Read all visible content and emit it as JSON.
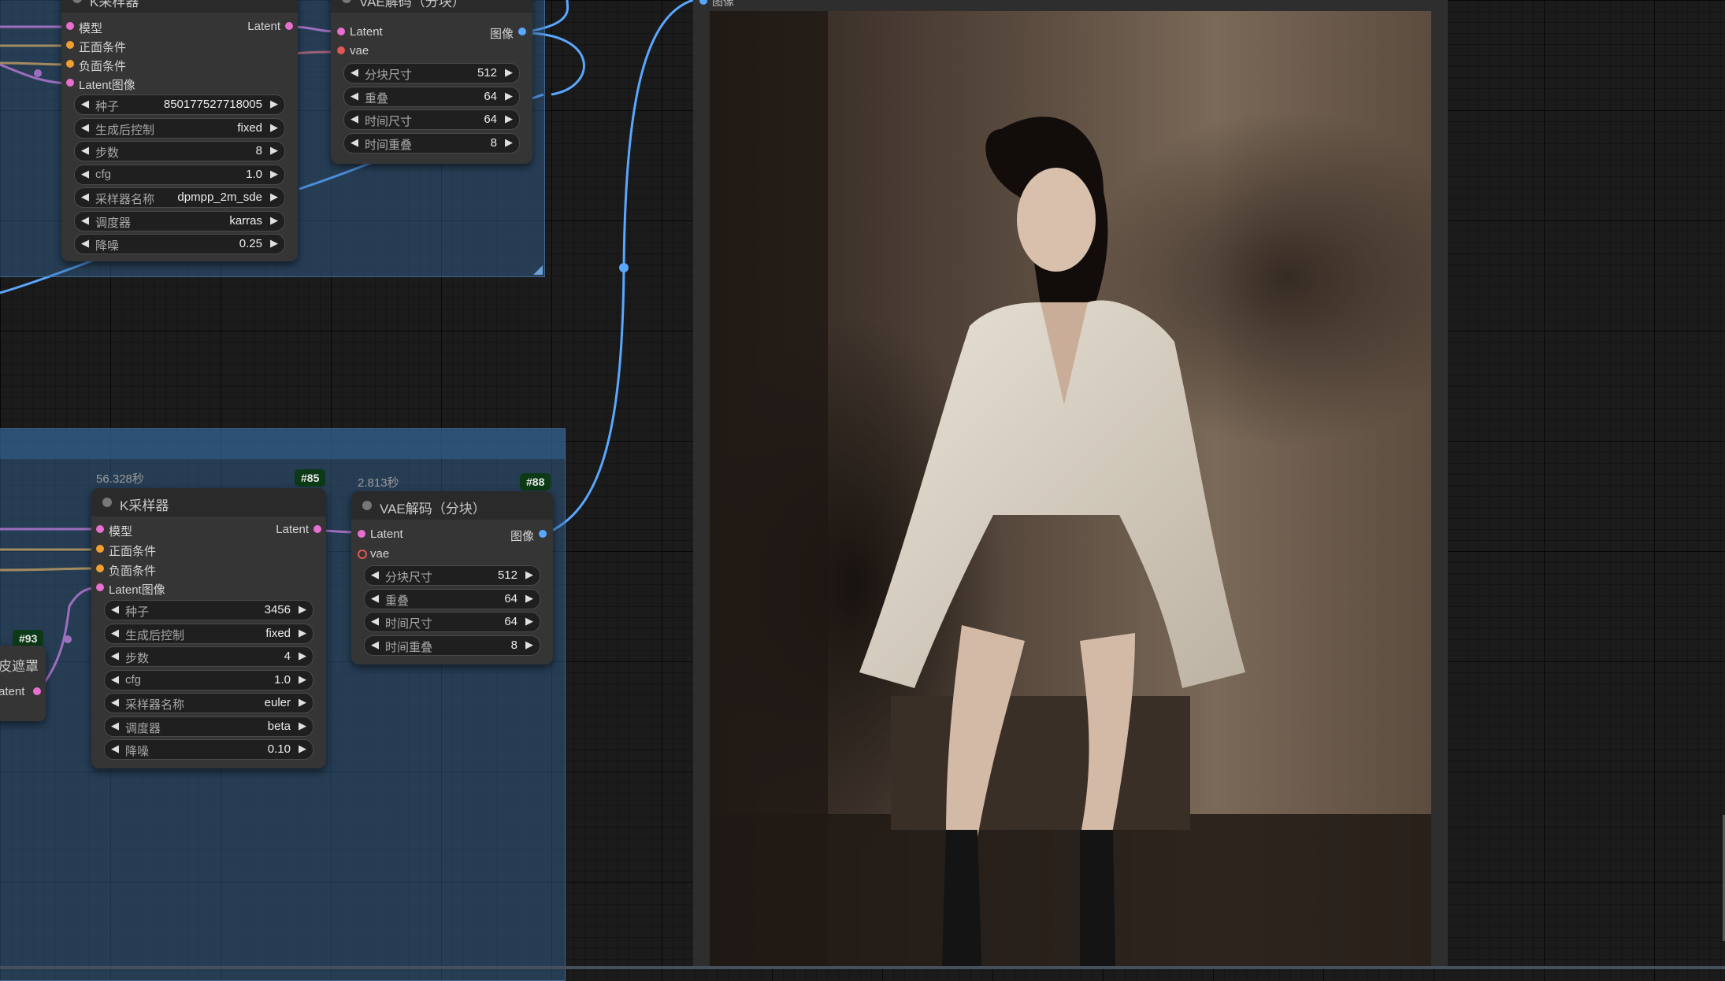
{
  "top_ksampler": {
    "title": "K采样器",
    "inputs": [
      "模型",
      "正面条件",
      "负面条件",
      "Latent图像"
    ],
    "output": "Latent",
    "widgets": [
      {
        "label": "种子",
        "value": "850177527718005"
      },
      {
        "label": "生成后控制",
        "value": "fixed"
      },
      {
        "label": "步数",
        "value": "8"
      },
      {
        "label": "cfg",
        "value": "1.0"
      },
      {
        "label": "采样器名称",
        "value": "dpmpp_2m_sde"
      },
      {
        "label": "调度器",
        "value": "karras"
      },
      {
        "label": "降噪",
        "value": "0.25"
      }
    ]
  },
  "top_vae": {
    "title": "VAE解码（分块）",
    "inputs": [
      "Latent",
      "vae"
    ],
    "output": "图像",
    "widgets": [
      {
        "label": "分块尺寸",
        "value": "512"
      },
      {
        "label": "重叠",
        "value": "64"
      },
      {
        "label": "时间尺寸",
        "value": "64"
      },
      {
        "label": "时间重叠",
        "value": "8"
      }
    ]
  },
  "bottom_ksampler": {
    "exec_time": "56.328秒",
    "id": "#85",
    "title": "K采样器",
    "inputs": [
      "模型",
      "正面条件",
      "负面条件",
      "Latent图像"
    ],
    "output": "Latent",
    "widgets": [
      {
        "label": "种子",
        "value": "3456"
      },
      {
        "label": "生成后控制",
        "value": "fixed"
      },
      {
        "label": "步数",
        "value": "4"
      },
      {
        "label": "cfg",
        "value": "1.0"
      },
      {
        "label": "采样器名称",
        "value": "euler"
      },
      {
        "label": "调度器",
        "value": "beta"
      },
      {
        "label": "降噪",
        "value": "0.10"
      }
    ]
  },
  "bottom_vae": {
    "exec_time": "2.813秒",
    "id": "#88",
    "title": "VAE解码（分块）",
    "inputs": [
      "Latent",
      "vae"
    ],
    "output": "图像",
    "widgets": [
      {
        "label": "分块尺寸",
        "value": "512"
      },
      {
        "label": "重叠",
        "value": "64"
      },
      {
        "label": "时间尺寸",
        "value": "64"
      },
      {
        "label": "时间重叠",
        "value": "8"
      }
    ]
  },
  "partial_node": {
    "id": "#93",
    "label": "皮遮罩",
    "output": "atent"
  },
  "preview": {
    "input_label": "图像"
  },
  "colors": {
    "model": "#e86fd0",
    "conditioning": "#f0a030",
    "vae": "#e45757",
    "image": "#5aa7ff",
    "badge": "#0c3a16",
    "group": "#376ea5"
  }
}
